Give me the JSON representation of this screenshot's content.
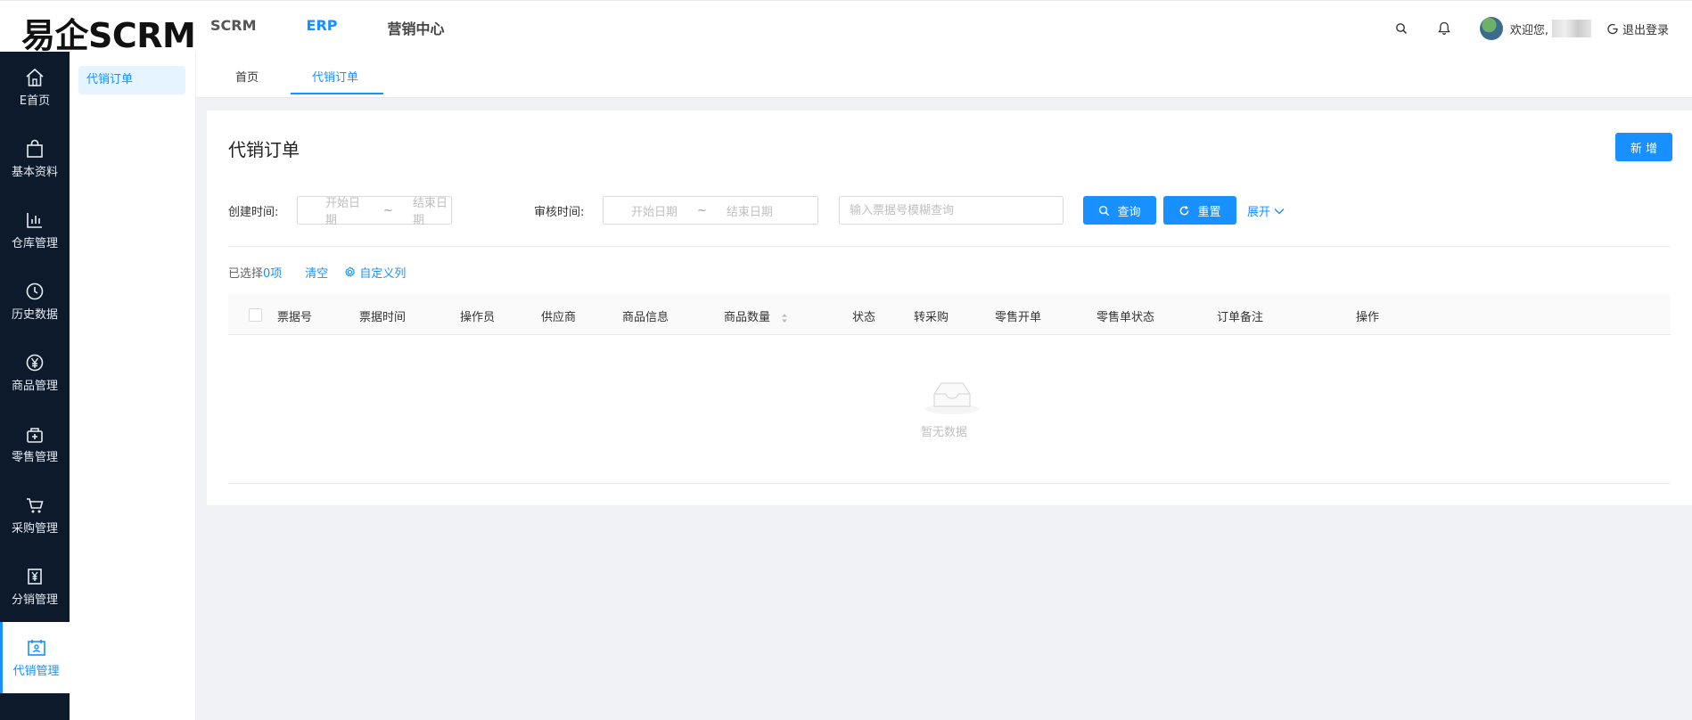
{
  "header": {
    "logo": "易企SCRM",
    "nav": [
      {
        "label": "SCRM"
      },
      {
        "label": "ERP"
      },
      {
        "label": "营销中心"
      }
    ],
    "welcome": "欢迎您,",
    "logout": "退出登录"
  },
  "sidebar": {
    "items": [
      {
        "label": "E首页",
        "icon": "home-icon"
      },
      {
        "label": "基本资料",
        "icon": "bag-icon"
      },
      {
        "label": "仓库管理",
        "icon": "bar-chart-icon"
      },
      {
        "label": "历史数据",
        "icon": "clock-icon"
      },
      {
        "label": "商品管理",
        "icon": "yen-circle-icon"
      },
      {
        "label": "零售管理",
        "icon": "retail-bag-icon"
      },
      {
        "label": "采购管理",
        "icon": "cart-icon"
      },
      {
        "label": "分销管理",
        "icon": "yen-box-icon"
      },
      {
        "label": "代销管理",
        "icon": "calendar-user-icon"
      }
    ]
  },
  "submenu": {
    "active": "代销订单"
  },
  "tabs": [
    {
      "label": "首页"
    },
    {
      "label": "代销订单"
    }
  ],
  "page": {
    "title": "代销订单",
    "new_button": "新 增"
  },
  "filters": {
    "create_label": "创建时间:",
    "audit_label": "审核时间:",
    "start_placeholder": "开始日期",
    "end_placeholder": "结束日期",
    "range_sep": "~",
    "search_placeholder": "输入票据号模糊查询",
    "query_button": "查询",
    "reset_button": "重置",
    "expand": "展开"
  },
  "selection": {
    "prefix": "已选择 ",
    "count": "0项",
    "clear": "清空",
    "custom_columns": "自定义列"
  },
  "table": {
    "columns": [
      "票据号",
      "票据时间",
      "操作员",
      "供应商",
      "商品信息",
      "商品数量",
      "状态",
      "转采购",
      "零售开单",
      "零售单状态",
      "订单备注",
      "操作"
    ],
    "rows": [],
    "empty_text": "暂无数据"
  },
  "colors": {
    "primary": "#1890ff",
    "sidebar_bg": "#0c1a2b"
  }
}
